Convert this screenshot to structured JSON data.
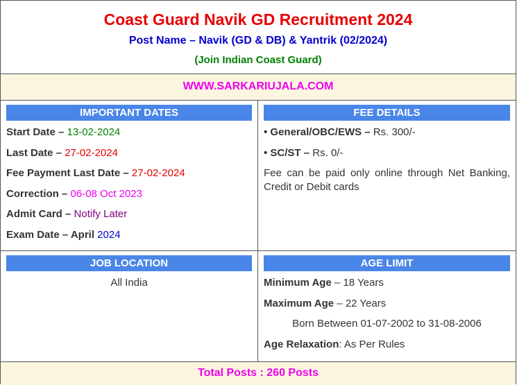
{
  "header": {
    "title": "Coast Guard Navik GD Recruitment 2024",
    "post_name": "Post Name – Navik (GD & DB) & Yantrik (02/2024)",
    "tagline": "(Join Indian Coast Guard)"
  },
  "site_url": "WWW.SARKARIUJALA.COM",
  "important_dates": {
    "heading": "IMPORTANT DATES",
    "items": [
      {
        "label": "Start Date –",
        "value": " 13-02-2024"
      },
      {
        "label": "Last Date –",
        "value": " 27-02-2024"
      },
      {
        "label": "Fee Payment Last Date –",
        "value": " 27-02-2024"
      },
      {
        "label": "Correction –",
        "value": " 06-08 Oct 2023"
      },
      {
        "label": "Admit Card –",
        "value": " Notify Later"
      },
      {
        "label": "Exam Date – April",
        "value": " 2024"
      }
    ]
  },
  "fee_details": {
    "heading": "FEE DETAILS",
    "items": [
      {
        "label": "• General/OBC/EWS –",
        "value": " Rs. 300/-"
      },
      {
        "label": "• SC/ST –",
        "value": " Rs. 0/-"
      }
    ],
    "note": "Fee can be paid only online through Net Banking, Credit or Debit cards"
  },
  "job_location": {
    "heading": "JOB LOCATION",
    "value": "All India"
  },
  "age_limit": {
    "heading": "AGE LIMIT",
    "min_label": "Minimum Age",
    "min_value": " – 18 Years",
    "max_label": "Maximum Age",
    "max_value": " – 22 Years",
    "born": "Born Between 01-07-2002 to 31-08-2006",
    "relax_label": "Age Relaxation",
    "relax_value": ": As Per Rules"
  },
  "total_posts": "Total Posts : 260 Posts"
}
